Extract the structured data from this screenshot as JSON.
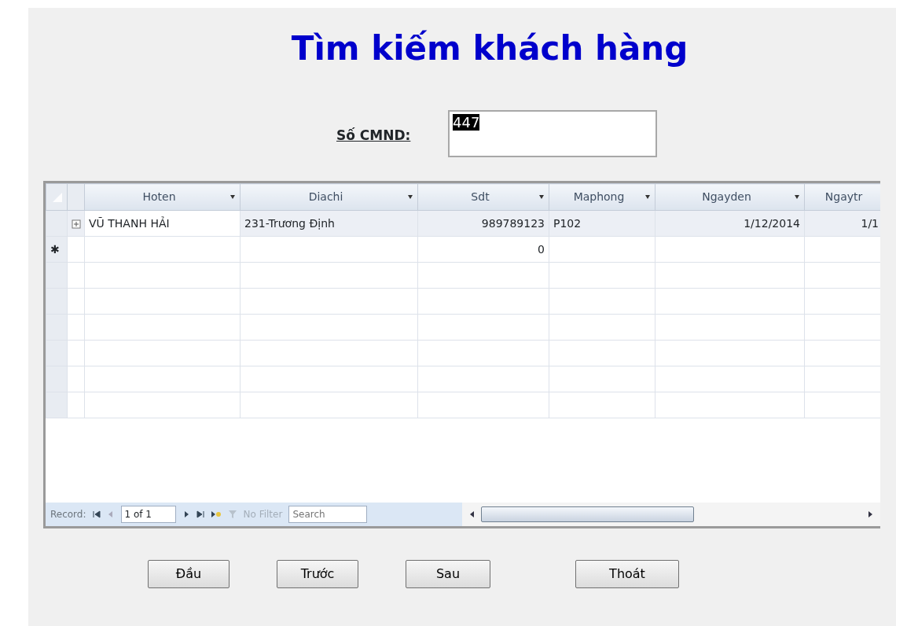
{
  "title": "Tìm kiếm khách hàng",
  "search": {
    "label": "Số CMND:",
    "value": "447",
    "value_selected": true
  },
  "table": {
    "columns": [
      "Hoten",
      "Diachi",
      "Sdt",
      "Maphong",
      "Ngayden",
      "Ngaytr"
    ],
    "rows": [
      {
        "cells": [
          "VŨ THANH HẢI",
          "231-Trương Định",
          "989789123",
          "P102",
          "1/12/2014",
          "1/1"
        ]
      }
    ],
    "new_row": {
      "marker": "✱",
      "cells": [
        "",
        "",
        "0",
        "",
        "",
        ""
      ]
    }
  },
  "navigator": {
    "label": "Record:",
    "position": "1 of 1",
    "filter": "No Filter",
    "search_placeholder": "Search"
  },
  "buttons": [
    "Đầu",
    "Trước",
    "Sau",
    "Thoát"
  ]
}
